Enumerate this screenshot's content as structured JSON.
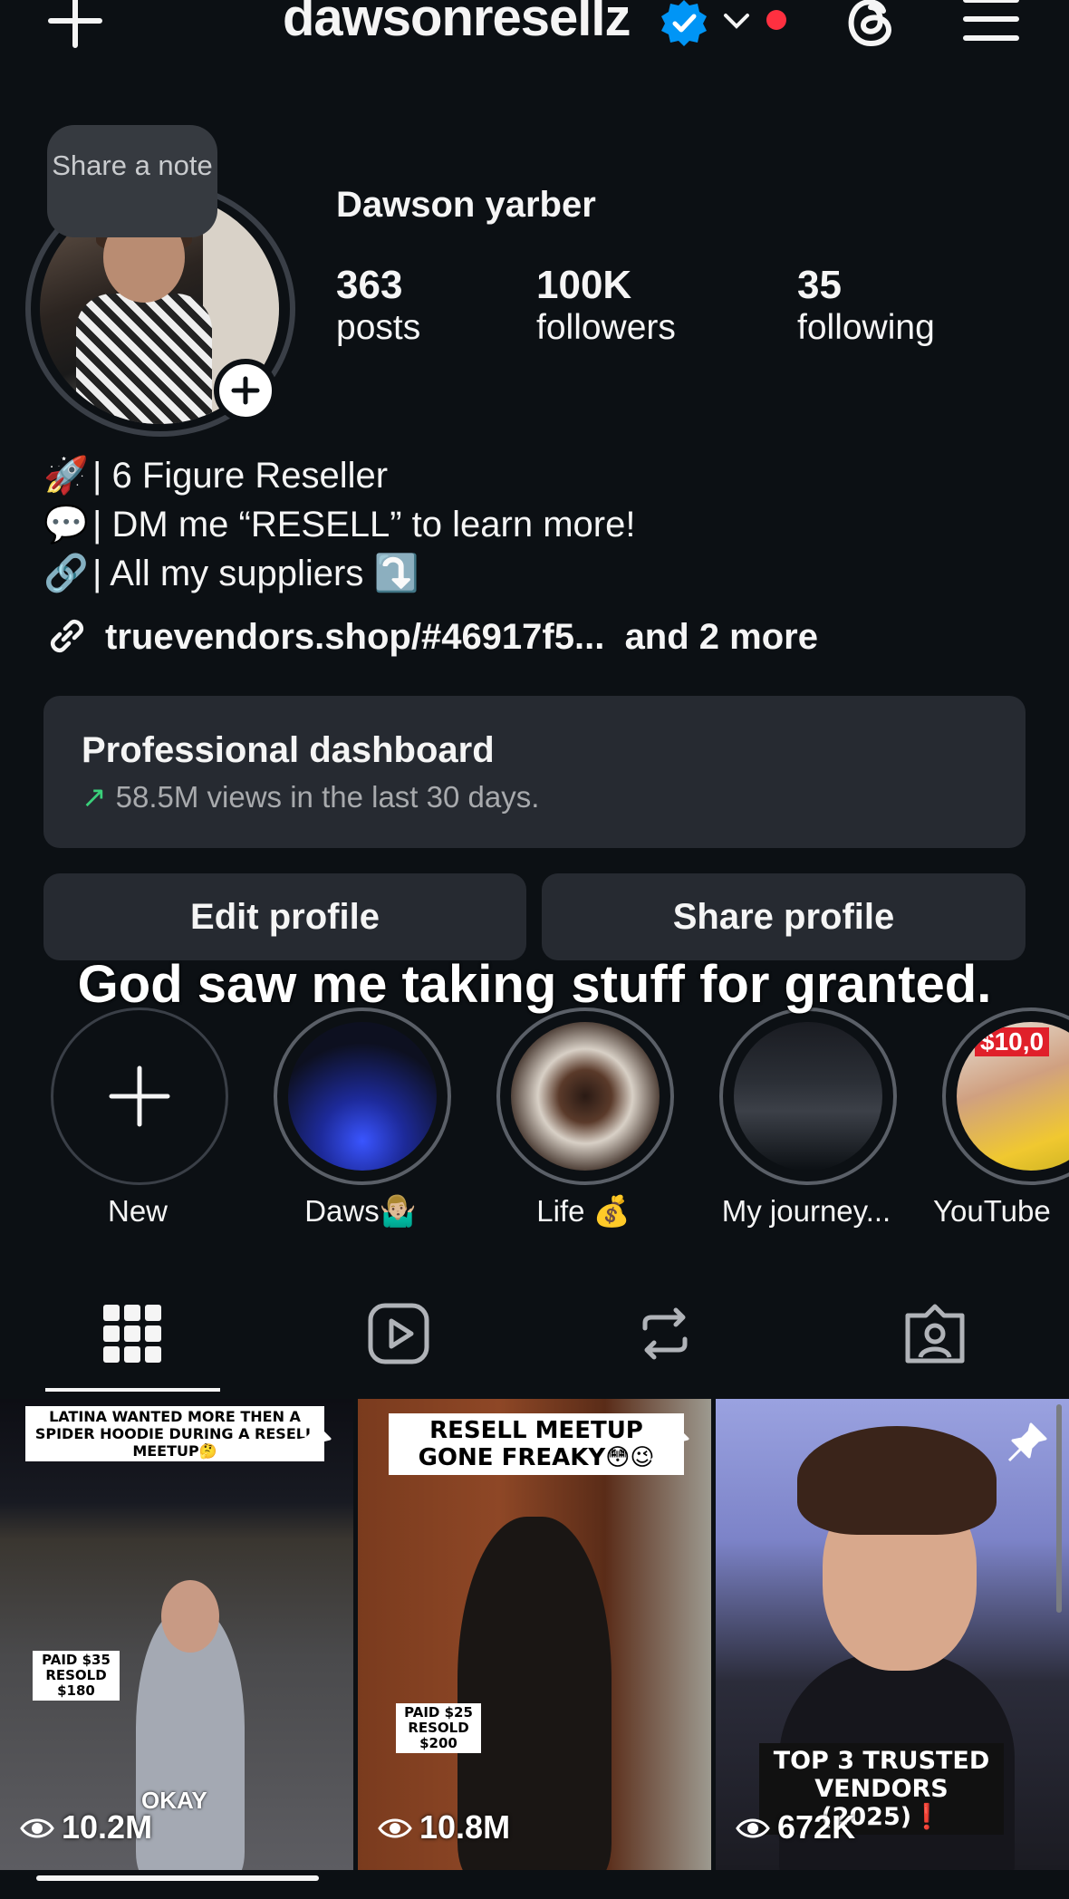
{
  "header": {
    "username": "dawsonresellz",
    "verified": true,
    "icons": [
      "plus-icon",
      "verified-badge-icon",
      "chevron-down-icon",
      "notification-dot",
      "threads-icon",
      "menu-icon"
    ]
  },
  "profile": {
    "note_text": "Share a note",
    "full_name": "Dawson yarber",
    "stats": [
      {
        "value": "363",
        "label": "posts"
      },
      {
        "value": "100K",
        "label": "followers"
      },
      {
        "value": "35",
        "label": "following"
      }
    ],
    "bio": [
      {
        "emoji": "🚀",
        "text": "| 6 Figure Reseller"
      },
      {
        "emoji": "💬",
        "text": "| DM me “RESELL” to learn more!"
      },
      {
        "emoji": "🔗",
        "text": "| All my suppliers ⤵️"
      }
    ],
    "link": "truevendors.shop/#46917f5...",
    "link_more": "and 2 more"
  },
  "dashboard": {
    "title": "Professional dashboard",
    "subtitle": "58.5M views in the last 30 days."
  },
  "buttons": {
    "edit": "Edit profile",
    "share": "Share profile"
  },
  "overlay_caption": "God saw me taking stuff for granted.",
  "highlights": [
    {
      "label": "New"
    },
    {
      "label": "Daws🤷🏼‍♂️"
    },
    {
      "label": "Life 💰"
    },
    {
      "label": "My journey..."
    },
    {
      "label": "YouTube"
    }
  ],
  "highlight_badge": "$10,0",
  "tabs": [
    "grid-icon",
    "reels-icon",
    "reposts-icon",
    "tagged-icon"
  ],
  "posts": [
    {
      "title": "LATINA WANTED MORE THEN A SPIDER HOODIE DURING A RESELL MEETUP🤔",
      "price": "PAID $35 RESOLD $180",
      "overlay": "OKAY",
      "views": "10.2M"
    },
    {
      "title": "RESELL MEETUP GONE FREAKY😳😉",
      "price": "PAID $25 RESOLD $200",
      "views": "10.8M"
    },
    {
      "title": "TOP 3 TRUSTED VENDORS (2025)❗",
      "views": "672K"
    }
  ],
  "colors": {
    "background": "#0c1014",
    "card": "#262a31",
    "accent_blue": "#0095f6",
    "notification_red": "#ff3040",
    "trend_green": "#3ad07a"
  }
}
